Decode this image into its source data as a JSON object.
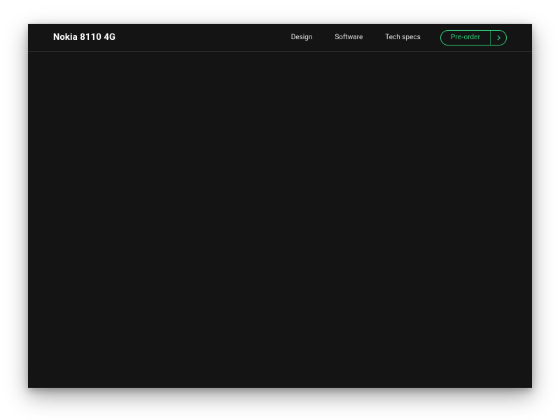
{
  "header": {
    "brand": "Nokia 8110 4G",
    "nav": [
      {
        "label": "Design"
      },
      {
        "label": "Software"
      },
      {
        "label": "Tech specs"
      }
    ],
    "cta": {
      "label": "Pre-order"
    }
  },
  "colors": {
    "background": "#141414",
    "accent": "#2fcf7a",
    "text": "#ffffff"
  }
}
